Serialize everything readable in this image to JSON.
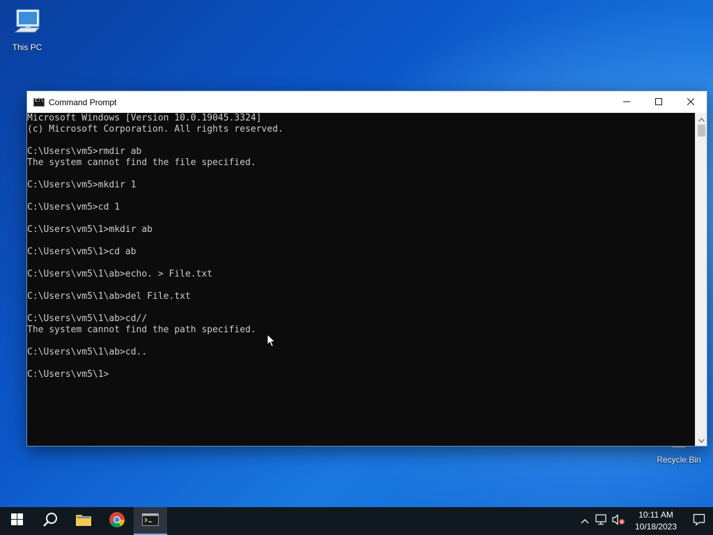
{
  "desktop": {
    "icons": [
      {
        "label": "This PC",
        "icon": "computer-icon"
      },
      {
        "label": "Recycle Bin",
        "icon": "recycle-bin-icon"
      }
    ]
  },
  "window": {
    "title": "Command Prompt",
    "icon": "cmd-icon",
    "buttons": {
      "minimize": "minimize-icon",
      "maximize": "maximize-icon",
      "close": "close-icon"
    },
    "background": "#0c0c0c",
    "text_color": "#cccccc"
  },
  "console": {
    "lines": [
      "Microsoft Windows [Version 10.0.19045.3324]",
      "(c) Microsoft Corporation. All rights reserved.",
      "",
      "C:\\Users\\vm5>rmdir ab",
      "The system cannot find the file specified.",
      "",
      "C:\\Users\\vm5>mkdir 1",
      "",
      "C:\\Users\\vm5>cd 1",
      "",
      "C:\\Users\\vm5\\1>mkdir ab",
      "",
      "C:\\Users\\vm5\\1>cd ab",
      "",
      "C:\\Users\\vm5\\1\\ab>echo. > File.txt",
      "",
      "C:\\Users\\vm5\\1\\ab>del File.txt",
      "",
      "C:\\Users\\vm5\\1\\ab>cd//",
      "The system cannot find the path specified.",
      "",
      "C:\\Users\\vm5\\1\\ab>cd..",
      "",
      "C:\\Users\\vm5\\1>"
    ]
  },
  "taskbar": {
    "items": [
      {
        "name": "start",
        "icon": "windows-logo-icon"
      },
      {
        "name": "search",
        "icon": "search-icon"
      },
      {
        "name": "file-explorer",
        "icon": "folder-icon"
      },
      {
        "name": "chrome",
        "icon": "chrome-icon"
      },
      {
        "name": "command-prompt",
        "icon": "cmd-icon",
        "active": true
      }
    ],
    "tray": {
      "icons": [
        "chevron-up-icon",
        "network-icon",
        "volume-muted-icon"
      ],
      "time": "10:11 AM",
      "date": "10/18/2023",
      "notification_icon": "notification-icon"
    }
  }
}
